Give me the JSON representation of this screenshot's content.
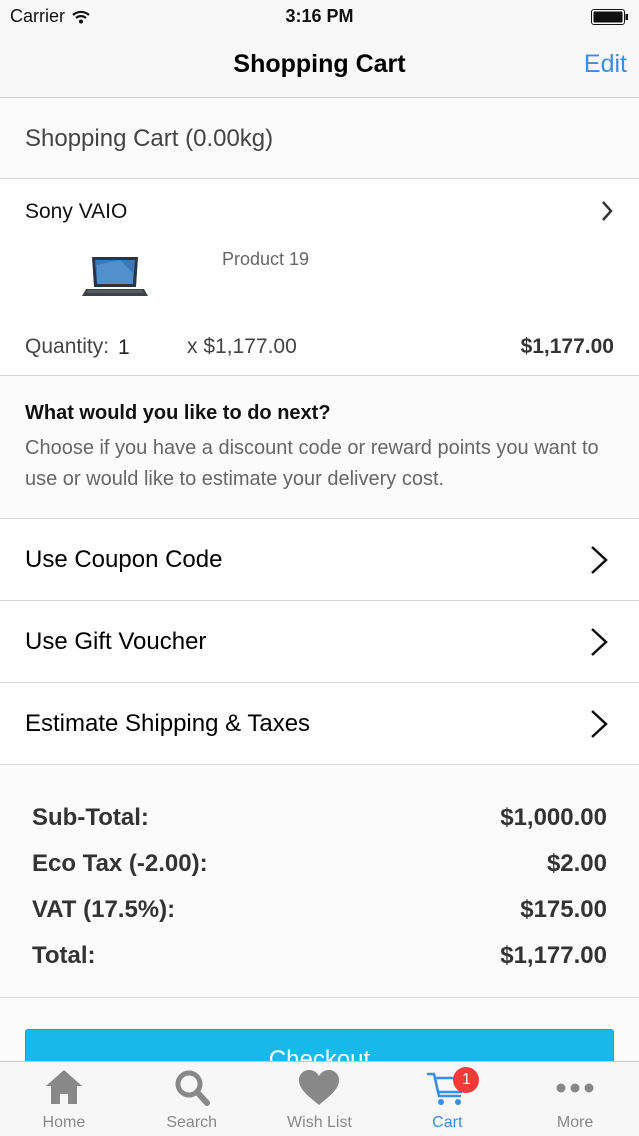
{
  "status_bar": {
    "carrier": "Carrier",
    "time": "3:16 PM"
  },
  "nav": {
    "title": "Shopping Cart",
    "edit_label": "Edit"
  },
  "cart": {
    "header": "Shopping Cart  (0.00kg)"
  },
  "product": {
    "name": "Sony VAIO",
    "model": "Product 19",
    "quantity_label": "Quantity:",
    "quantity": "1",
    "unit_price": "x $1,177.00",
    "line_total": "$1,177.00",
    "image_icon": "laptop-icon"
  },
  "next_steps": {
    "title": "What would you like to do next?",
    "description": "Choose if you have a discount code or reward points you want to use or would like to estimate your delivery cost."
  },
  "options": [
    {
      "label": "Use Coupon Code"
    },
    {
      "label": "Use Gift Voucher"
    },
    {
      "label": "Estimate Shipping & Taxes"
    }
  ],
  "totals": [
    {
      "label": "Sub-Total:",
      "value": "$1,000.00"
    },
    {
      "label": "Eco Tax (-2.00):",
      "value": "$2.00"
    },
    {
      "label": "VAT (17.5%):",
      "value": "$175.00"
    },
    {
      "label": "Total:",
      "value": "$1,177.00"
    }
  ],
  "checkout": {
    "label": "Checkout"
  },
  "tabs": [
    {
      "label": "Home",
      "icon": "home-icon",
      "active": false
    },
    {
      "label": "Search",
      "icon": "search-icon",
      "active": false
    },
    {
      "label": "Wish List",
      "icon": "heart-icon",
      "active": false
    },
    {
      "label": "Cart",
      "icon": "cart-icon",
      "active": true,
      "badge": "1"
    },
    {
      "label": "More",
      "icon": "more-icon",
      "active": false
    }
  ],
  "colors": {
    "accent": "#3a8ee6",
    "checkout": "#17b9ea",
    "badge": "#f23a3a"
  }
}
